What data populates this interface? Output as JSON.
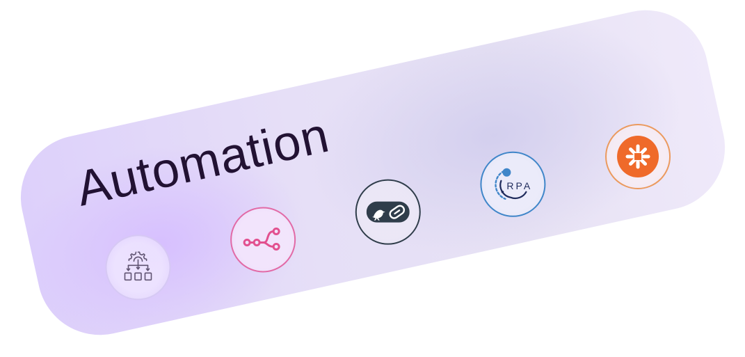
{
  "card": {
    "title": "Automation"
  },
  "icons": [
    {
      "name": "workflow-gear-icon",
      "color": "#6a5c7c"
    },
    {
      "name": "n8n-icon",
      "color": "#e2508f"
    },
    {
      "name": "tray-io-icon",
      "color": "#2f3d4a"
    },
    {
      "name": "rpa-icon",
      "text": "RPA",
      "color": "#3f86c9"
    },
    {
      "name": "zapier-icon",
      "color": "#ef6a2a"
    }
  ],
  "colors": {
    "title": "#221233",
    "card_gradient_left": "#ddd0fb",
    "card_gradient_right": "#efe9fa"
  }
}
